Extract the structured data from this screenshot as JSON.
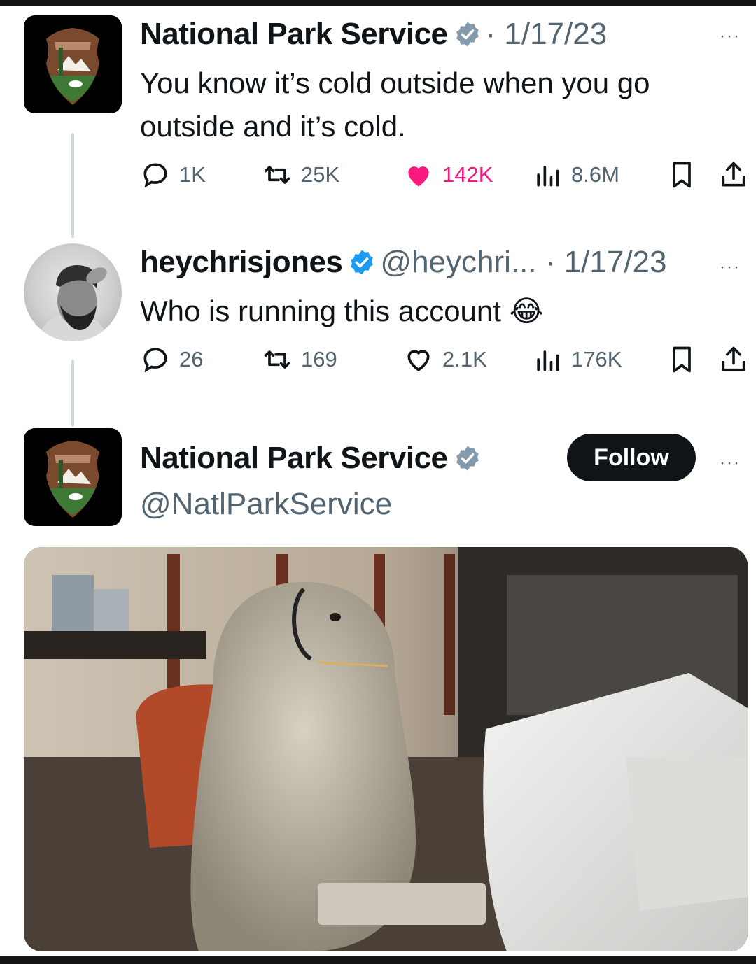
{
  "tweet1": {
    "name": "National Park Service",
    "date": "· 1/17/23",
    "text": "You know it’s cold outside when you go outside and it’s cold.",
    "replies": "1K",
    "retweets": "25K",
    "likes": "142K",
    "views": "8.6M",
    "more": "···"
  },
  "tweet2": {
    "name": "heychrisjones",
    "handle_date": "@heychri... · 1/17/23",
    "text": "Who is running this account",
    "emoji": "😂",
    "replies": "26",
    "retweets": "169",
    "likes": "2.1K",
    "views": "176K",
    "more": "···"
  },
  "tweet3": {
    "name": "National Park Service",
    "handle": "@NatlParkService",
    "follow_label": "Follow",
    "more": "···"
  },
  "colors": {
    "verified_blue": "#1d9bf0",
    "verified_gray": "#829aab",
    "like_pink": "#f91880",
    "text_gray": "#536471"
  }
}
